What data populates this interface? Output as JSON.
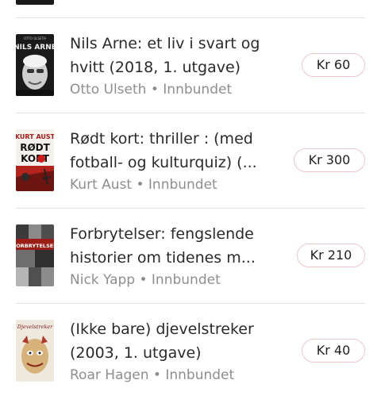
{
  "listings": [
    {
      "title_line1": "Nils Arne: et liv i svart og",
      "title_line2": "hvitt (2018, 1. utgave)",
      "author": "Otto Ulseth",
      "binding": "Innbundet",
      "separator": "•",
      "price": "Kr 60",
      "cover_text": "NILS ARNE",
      "cover_subtext": "OTTO ULSETH"
    },
    {
      "title_line1": "Rødt kort: thriller : (med",
      "title_line2": "fotball- og kulturquiz) (...",
      "author": "Kurt Aust",
      "binding": "Innbundet",
      "separator": "•",
      "price": "Kr 300",
      "cover_text_top": "KURT AUST",
      "cover_text_mid": "RØDT",
      "cover_text_bottom": "KORT"
    },
    {
      "title_line1": "Forbrytelser: fengslende",
      "title_line2": "historier om tidenes m...",
      "author": "Nick Yapp",
      "binding": "Innbundet",
      "separator": "•",
      "price": "Kr 210",
      "cover_text": "FORBRYTELSER"
    },
    {
      "title_line1": "(Ikke bare) djevelstreker",
      "title_line2": "(2003, 1. utgave)",
      "author": "Roar Hagen",
      "binding": "Innbundet",
      "separator": "•",
      "price": "Kr 40",
      "cover_text": "Djevelstreker"
    }
  ],
  "colors": {
    "price_border": "#f0c6c8",
    "meta_text": "#8e8e8e",
    "divider": "#e3e3e3"
  }
}
